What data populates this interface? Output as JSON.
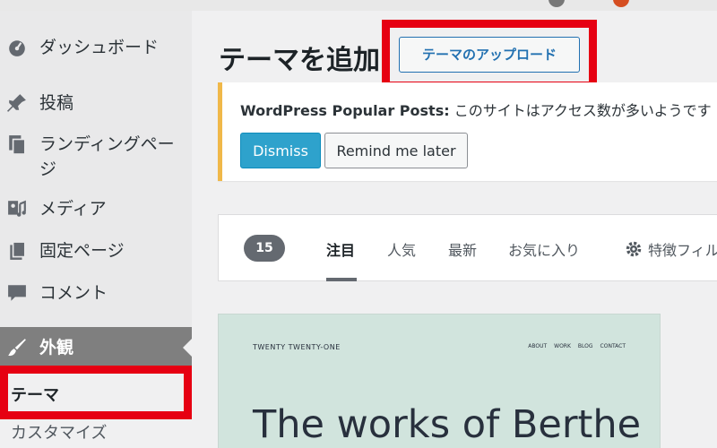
{
  "sidebar": {
    "items": [
      {
        "label": "ダッシュボード",
        "icon": "dashboard-icon"
      },
      {
        "label": "投稿",
        "icon": "pin-icon"
      },
      {
        "label": "ランディングページ",
        "label_line1": "ランディングペー",
        "label_line2": "ジ",
        "icon": "pages-icon"
      },
      {
        "label": "メディア",
        "icon": "media-icon"
      },
      {
        "label": "固定ページ",
        "icon": "page-icon"
      },
      {
        "label": "コメント",
        "icon": "comment-icon"
      }
    ],
    "active_label": "外観",
    "active_icon": "brush-icon",
    "submenu": [
      "テーマ",
      "カスタマイズ"
    ]
  },
  "header": {
    "title": "テーマを追加",
    "upload_button": "テーマのアップロード"
  },
  "notice": {
    "plugin": "WordPress Popular Posts:",
    "message": " このサイトはアクセス数が多いようです",
    "dismiss": "Dismiss",
    "remind": "Remind me later"
  },
  "filter": {
    "count": "15",
    "tabs": [
      "注目",
      "人気",
      "最新",
      "お気に入り"
    ],
    "feature_filter": "特徴フィル"
  },
  "theme_preview": {
    "brand": "TWENTY TWENTY-ONE",
    "nav": [
      "ABOUT",
      "WORK",
      "BLOG",
      "CONTACT"
    ],
    "headline": "The works of Berthe"
  },
  "colors": {
    "accent": "#2271b1",
    "dismiss": "#2ea2cc",
    "highlight": "#e60012",
    "notice_border": "#f0b849"
  }
}
